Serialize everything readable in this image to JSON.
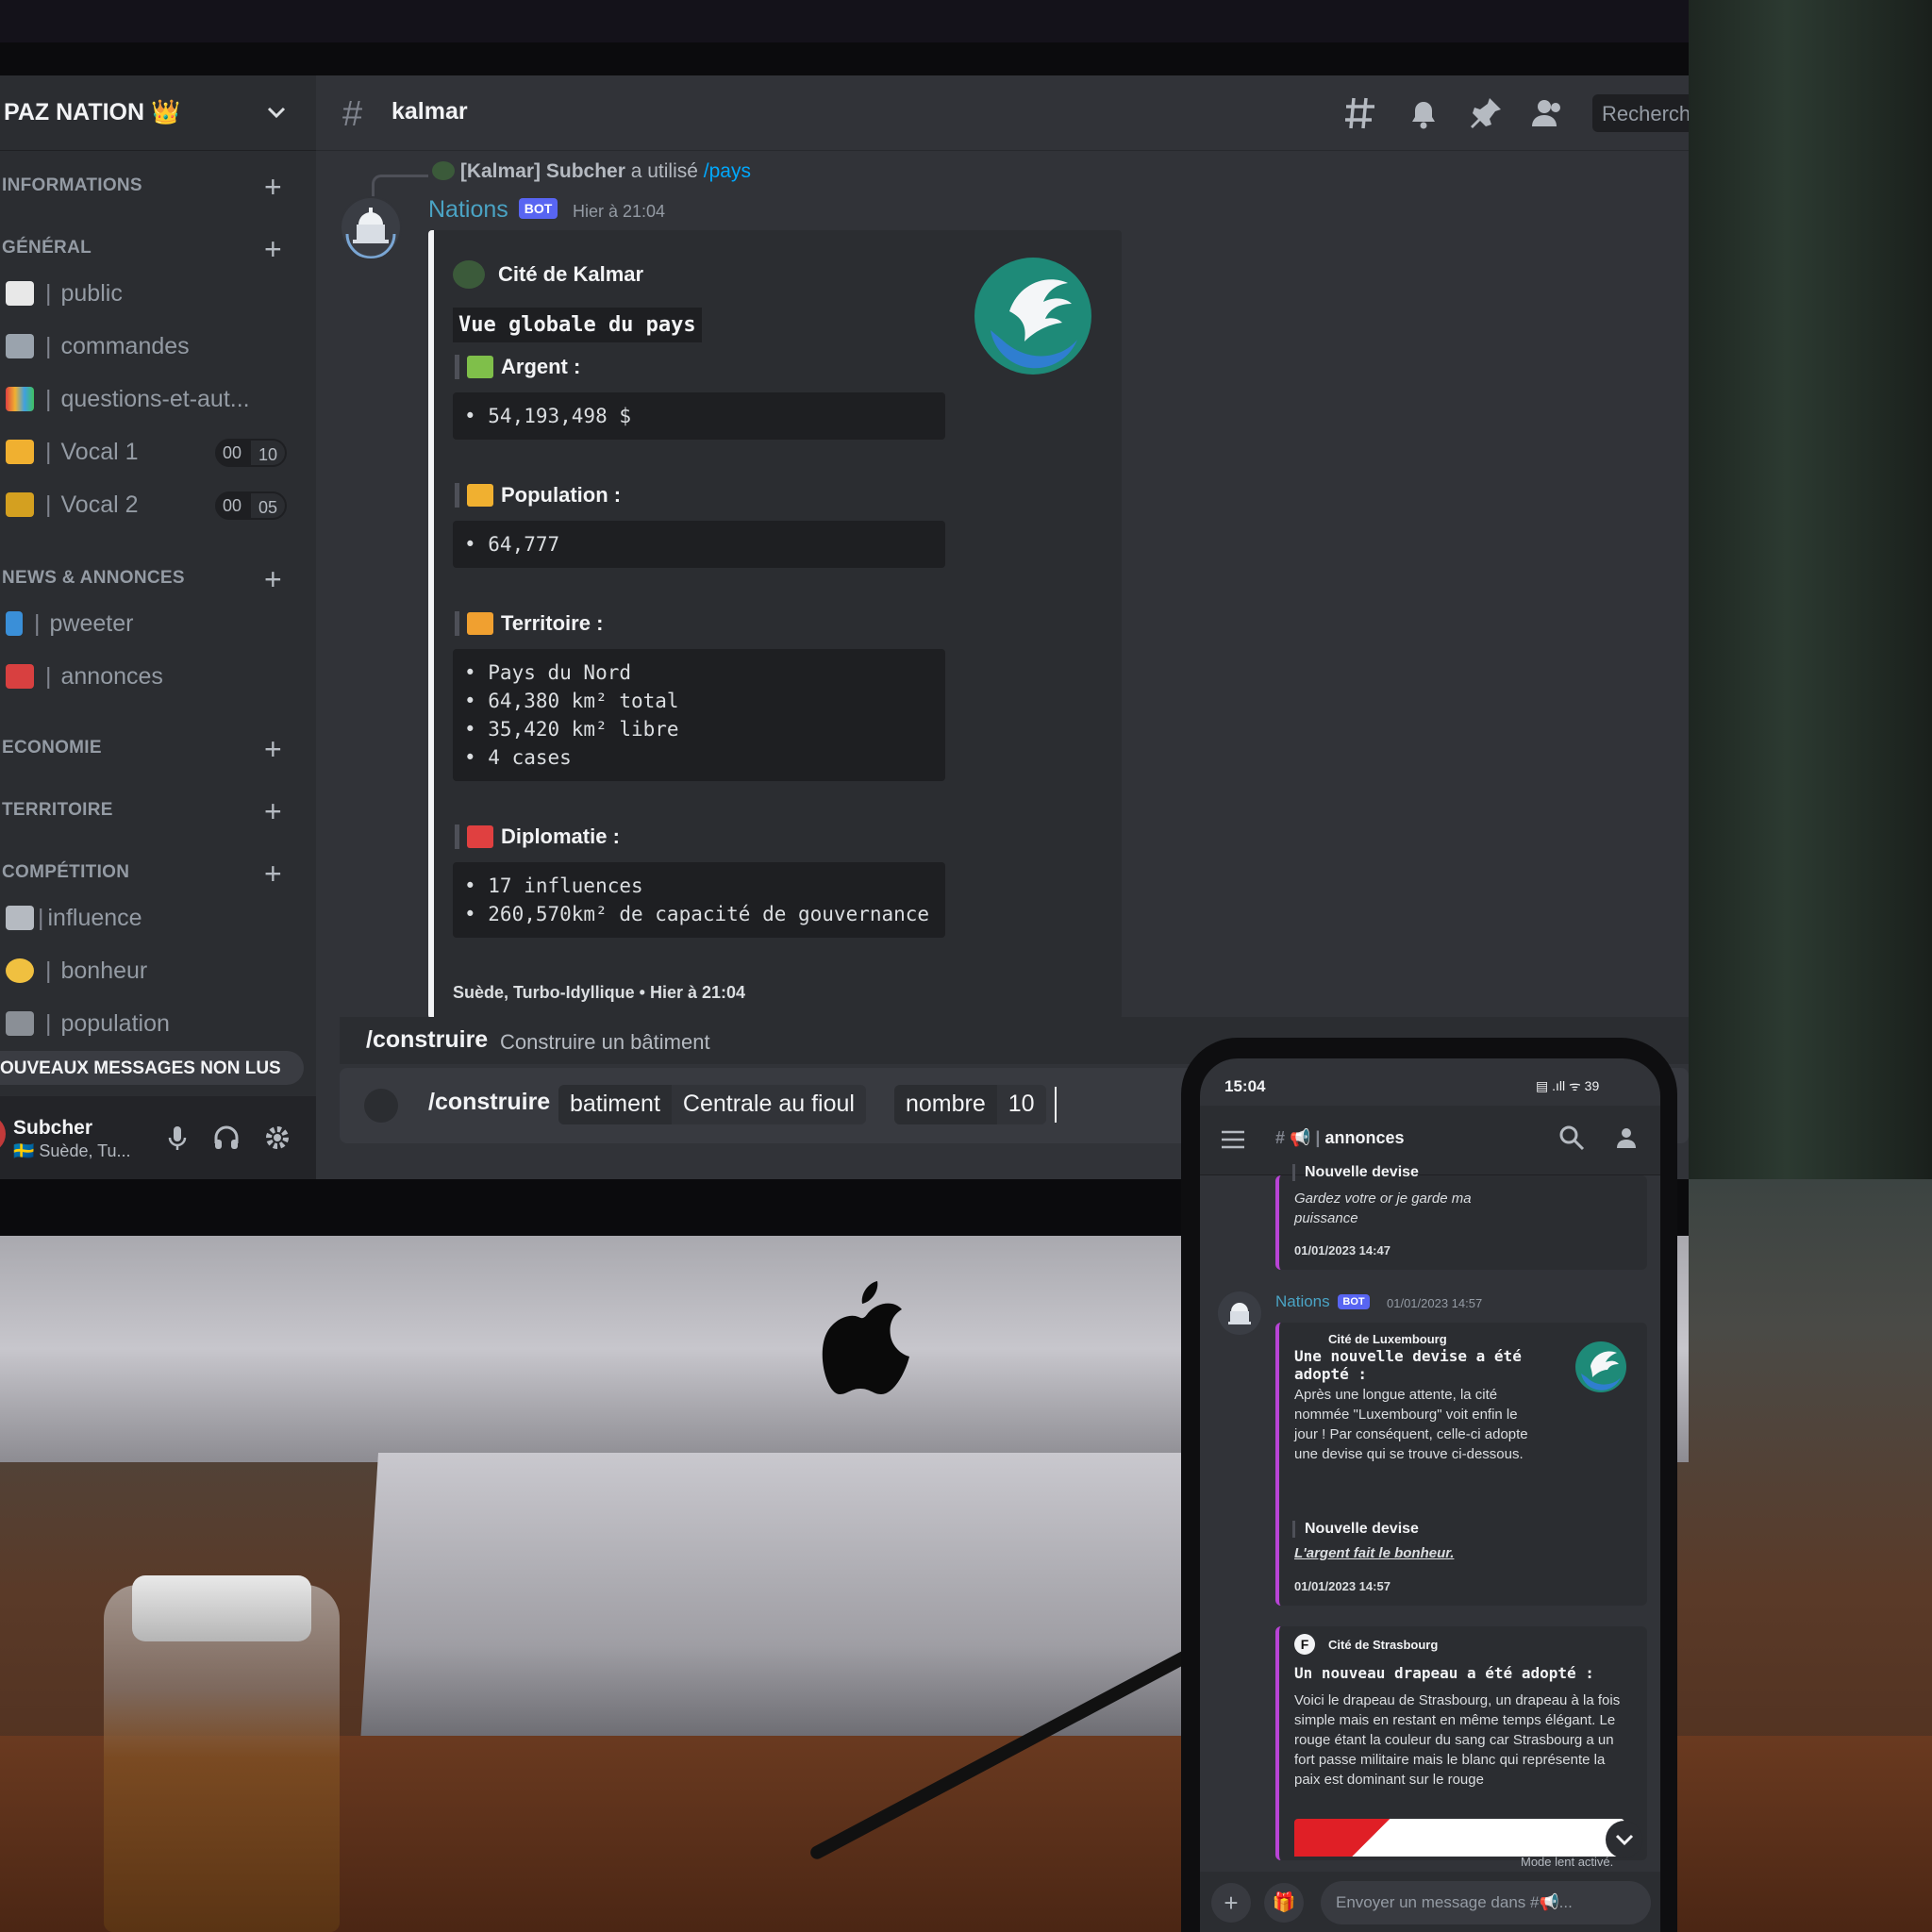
{
  "server": {
    "name": "PAZ NATION 👑"
  },
  "categories": [
    {
      "label": "INFORMATIONS"
    },
    {
      "label": "GÉNÉRAL"
    },
    {
      "label": "NEWS & ANNONCES"
    },
    {
      "label": "ECONOMIE"
    },
    {
      "label": "TERRITOIRE"
    },
    {
      "label": "COMPÉTITION"
    }
  ],
  "channels": {
    "general": [
      {
        "name": "public",
        "color": "#e8e8e8"
      },
      {
        "name": "commandes",
        "color": "#9aa3ad"
      },
      {
        "name": "questions-et-aut...",
        "color": "#e0a040"
      }
    ],
    "voice": [
      {
        "name": "Vocal 1",
        "count": "00",
        "limit": "10",
        "color": "#f0b030"
      },
      {
        "name": "Vocal 2",
        "count": "00",
        "limit": "05",
        "color": "#d4a020"
      }
    ],
    "news": [
      {
        "name": "pweeter",
        "color": "#3a8fd8"
      },
      {
        "name": "annonces",
        "color": "#d84040"
      }
    ],
    "competition": [
      {
        "name": "influence",
        "color": "#b5bac1"
      },
      {
        "name": "bonheur",
        "color": "#f0c040"
      },
      {
        "name": "population",
        "color": "#8a8f96"
      }
    ]
  },
  "new_messages_banner": "OUVEAUX MESSAGES NON LUS",
  "user": {
    "name": "Subcher",
    "status": "🇸🇪 Suède, Tu..."
  },
  "header": {
    "channel": "kalmar",
    "search_placeholder": "Recherch"
  },
  "message": {
    "reply": {
      "author": "[Kalmar] Subcher",
      "action": "a utilisé",
      "command": "/pays"
    },
    "author": "Nations",
    "bot_tag": "BOT",
    "time": "Hier à 21:04",
    "embed": {
      "author": "Cité de Kalmar",
      "title": "Vue globale du pays",
      "fields": [
        {
          "name": "Argent :",
          "lines": [
            "• 54,193,498 $"
          ],
          "emoji_color": "#7fbf4a"
        },
        {
          "name": "Population :",
          "lines": [
            "• 64,777"
          ],
          "emoji_color": "#f0b030"
        },
        {
          "name": "Territoire :",
          "lines": [
            "• Pays du Nord",
            "• 64,380 km² total",
            "• 35,420 km² libre",
            "• 4 cases"
          ],
          "emoji_color": "#f0a030"
        },
        {
          "name": "Diplomatie :",
          "lines": [
            "• 17 influences",
            "• 260,570km² de capacité de gouvernance"
          ],
          "emoji_color": "#e04040"
        }
      ],
      "footer": "Suède, Turbo-Idyllique • Hier à 21:04"
    }
  },
  "command_hint": {
    "command": "/construire",
    "description": "Construire un bâtiment"
  },
  "command_input": {
    "command": "/construire",
    "options": [
      {
        "key": "batiment",
        "value": "Centrale au fioul"
      },
      {
        "key": "nombre",
        "value": "10"
      }
    ]
  },
  "phone": {
    "time": "15:04",
    "status_right": "▤ .ıll ᯤ 39",
    "channel": "annonces",
    "post1": {
      "quote_title": "Nouvelle devise",
      "quote_text": "Gardez votre or je garde ma puissance",
      "date": "01/01/2023 14:47"
    },
    "post2": {
      "author": "Nations",
      "bot_tag": "BOT",
      "time": "01/01/2023 14:57",
      "embed_author": "Cité de Luxembourg",
      "title": "Une nouvelle devise a été adopté :",
      "body": "Après une longue attente, la cité nommée \"Luxembourg\" voit enfin le jour ! Par conséquent, celle-ci adopte une devise qui se trouve ci-dessous.",
      "quote_title": "Nouvelle devise",
      "quote_text": "L'argent fait le bonheur.",
      "date": "01/01/2023 14:57"
    },
    "post3": {
      "embed_author": "Cité de Strasbourg",
      "author_initial": "F",
      "title": "Un nouveau drapeau a été adopté :",
      "body": "Voici le drapeau de Strasbourg, un drapeau à la fois simple mais en restant en même temps élégant. Le rouge étant la couleur du sang car Strasbourg a un fort passe militaire mais le blanc qui représente la paix est dominant sur le rouge"
    },
    "slow_mode": "Mode lent activé.",
    "input_placeholder": "Envoyer un message dans #📢..."
  }
}
